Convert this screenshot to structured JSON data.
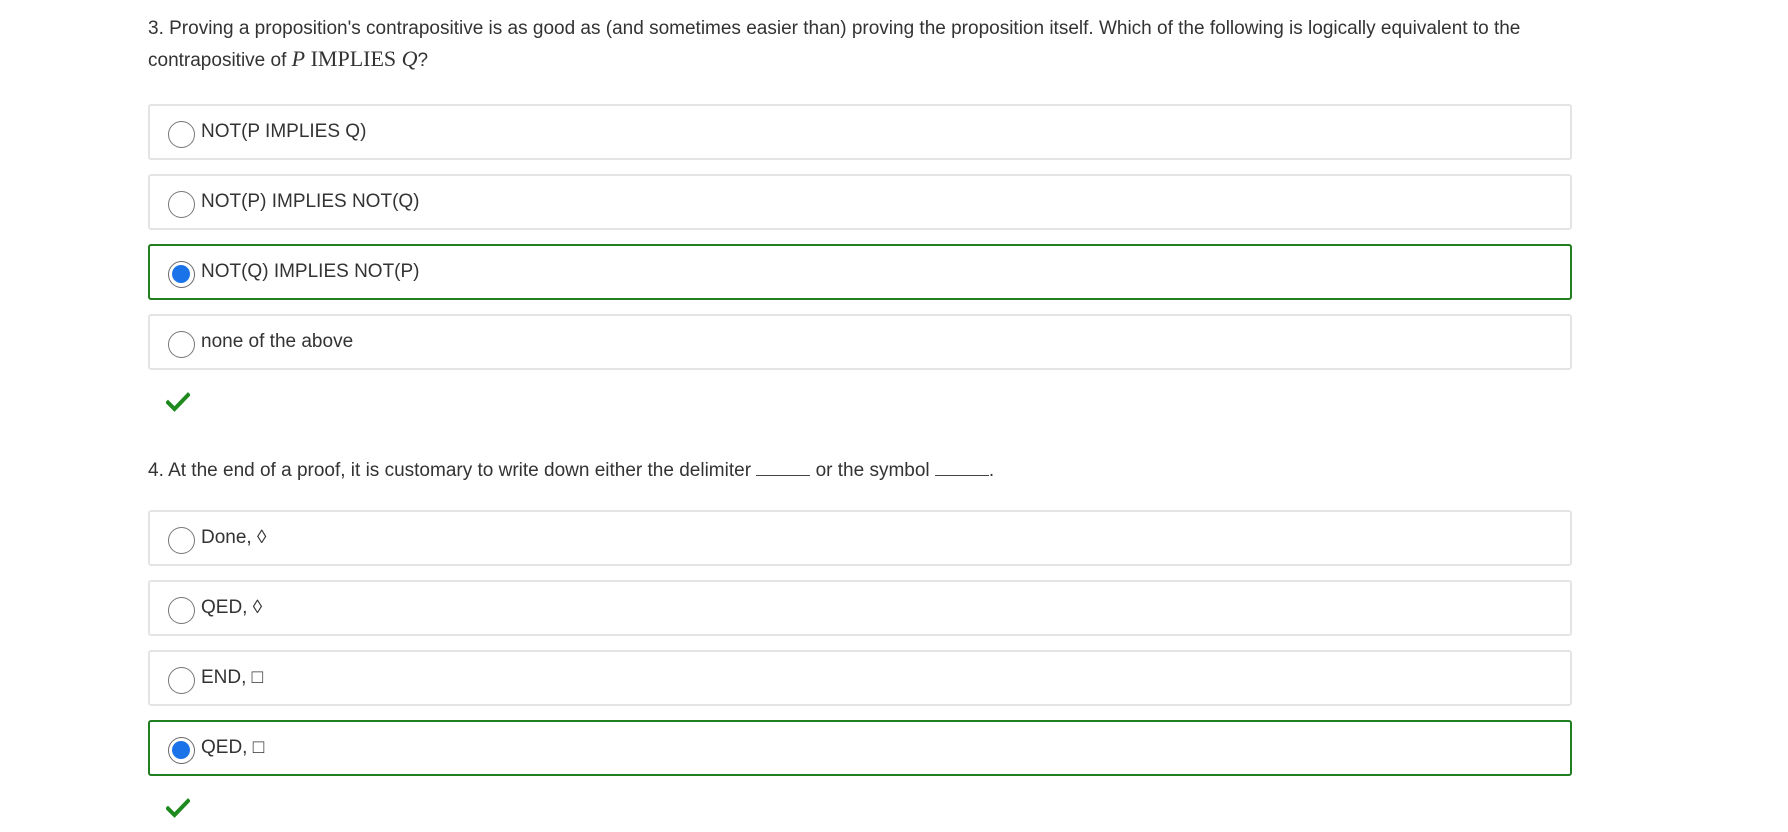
{
  "q3": {
    "prompt_text": "3. Proving a proposition's contrapositive is as good as (and sometimes easier than) proving the proposition itself. Which of the following is logically equivalent to the contrapositive of ",
    "math_p": "P",
    "math_implies": "IMPLIES",
    "math_q": "Q",
    "prompt_end": "?",
    "options": [
      {
        "label": "NOT(P IMPLIES Q)",
        "selected": false
      },
      {
        "label": "NOT(P) IMPLIES NOT(Q)",
        "selected": false
      },
      {
        "label": "NOT(Q) IMPLIES NOT(P)",
        "selected": true
      },
      {
        "label": "none of the above",
        "selected": false
      }
    ],
    "result": "correct"
  },
  "q4": {
    "prompt_part1": "4. At the end of a proof, it is customary to write down either the delimiter ",
    "prompt_part2": " or the symbol ",
    "prompt_end": ".",
    "options": [
      {
        "label": "Done, ◊",
        "selected": false
      },
      {
        "label": "QED, ◊",
        "selected": false
      },
      {
        "label": "END, □",
        "selected": false
      },
      {
        "label": "QED, □",
        "selected": true
      }
    ],
    "result": "correct"
  },
  "colors": {
    "selected_border": "#208020",
    "radio_fill": "#1a73e8",
    "check": "#1e8a1e",
    "option_border": "#e4e4e4"
  },
  "icons": {
    "correct": "checkmark-icon"
  }
}
